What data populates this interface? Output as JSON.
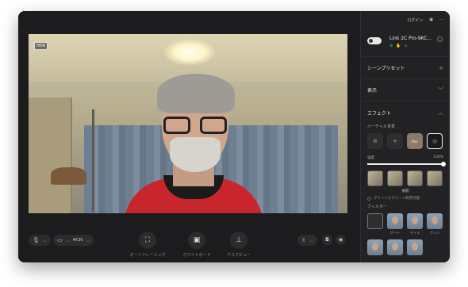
{
  "window": {
    "badge": "HDR"
  },
  "toolbar": {
    "resolution": "4K30",
    "tools": [
      {
        "label": "オートフレーミング",
        "icon": "auto-framing-icon"
      },
      {
        "label": "ホワイトボード",
        "icon": "whiteboard-icon"
      },
      {
        "label": "デスクビュー",
        "icon": "desk-view-icon"
      }
    ]
  },
  "sidebar": {
    "login": "ログイン",
    "device_name": "Link 2C Pro-9KC…",
    "sections": {
      "scene_presets": "シーンプリセット",
      "display": "表示",
      "effects": "エフェクト"
    },
    "virtual_bg_label": "バーチャル背景",
    "blur_label": "Blur",
    "strength_label": "強度",
    "strength_value": "100%",
    "strength": 1.0,
    "scene_label": "展開",
    "greenscreen_label": "グリーンスクリーン利用可能",
    "filter_label": "フィルター",
    "filters": [
      "ポート",
      "デイラ",
      "ヴィン"
    ]
  }
}
